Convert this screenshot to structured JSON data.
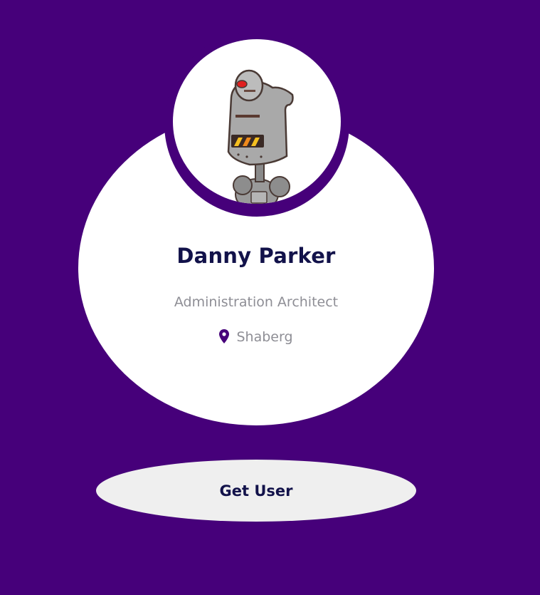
{
  "colors": {
    "background": "#46007a",
    "card": "#ffffff",
    "name_text": "#12124a",
    "muted_text": "#8e8e95",
    "button_bg": "#efefef",
    "pin_icon": "#46007a"
  },
  "profile": {
    "name": "Danny Parker",
    "title": "Administration Architect",
    "location": "Shaberg",
    "avatar": "robot-avatar",
    "location_icon": "map-pin-icon"
  },
  "actions": {
    "get_user_label": "Get User"
  }
}
